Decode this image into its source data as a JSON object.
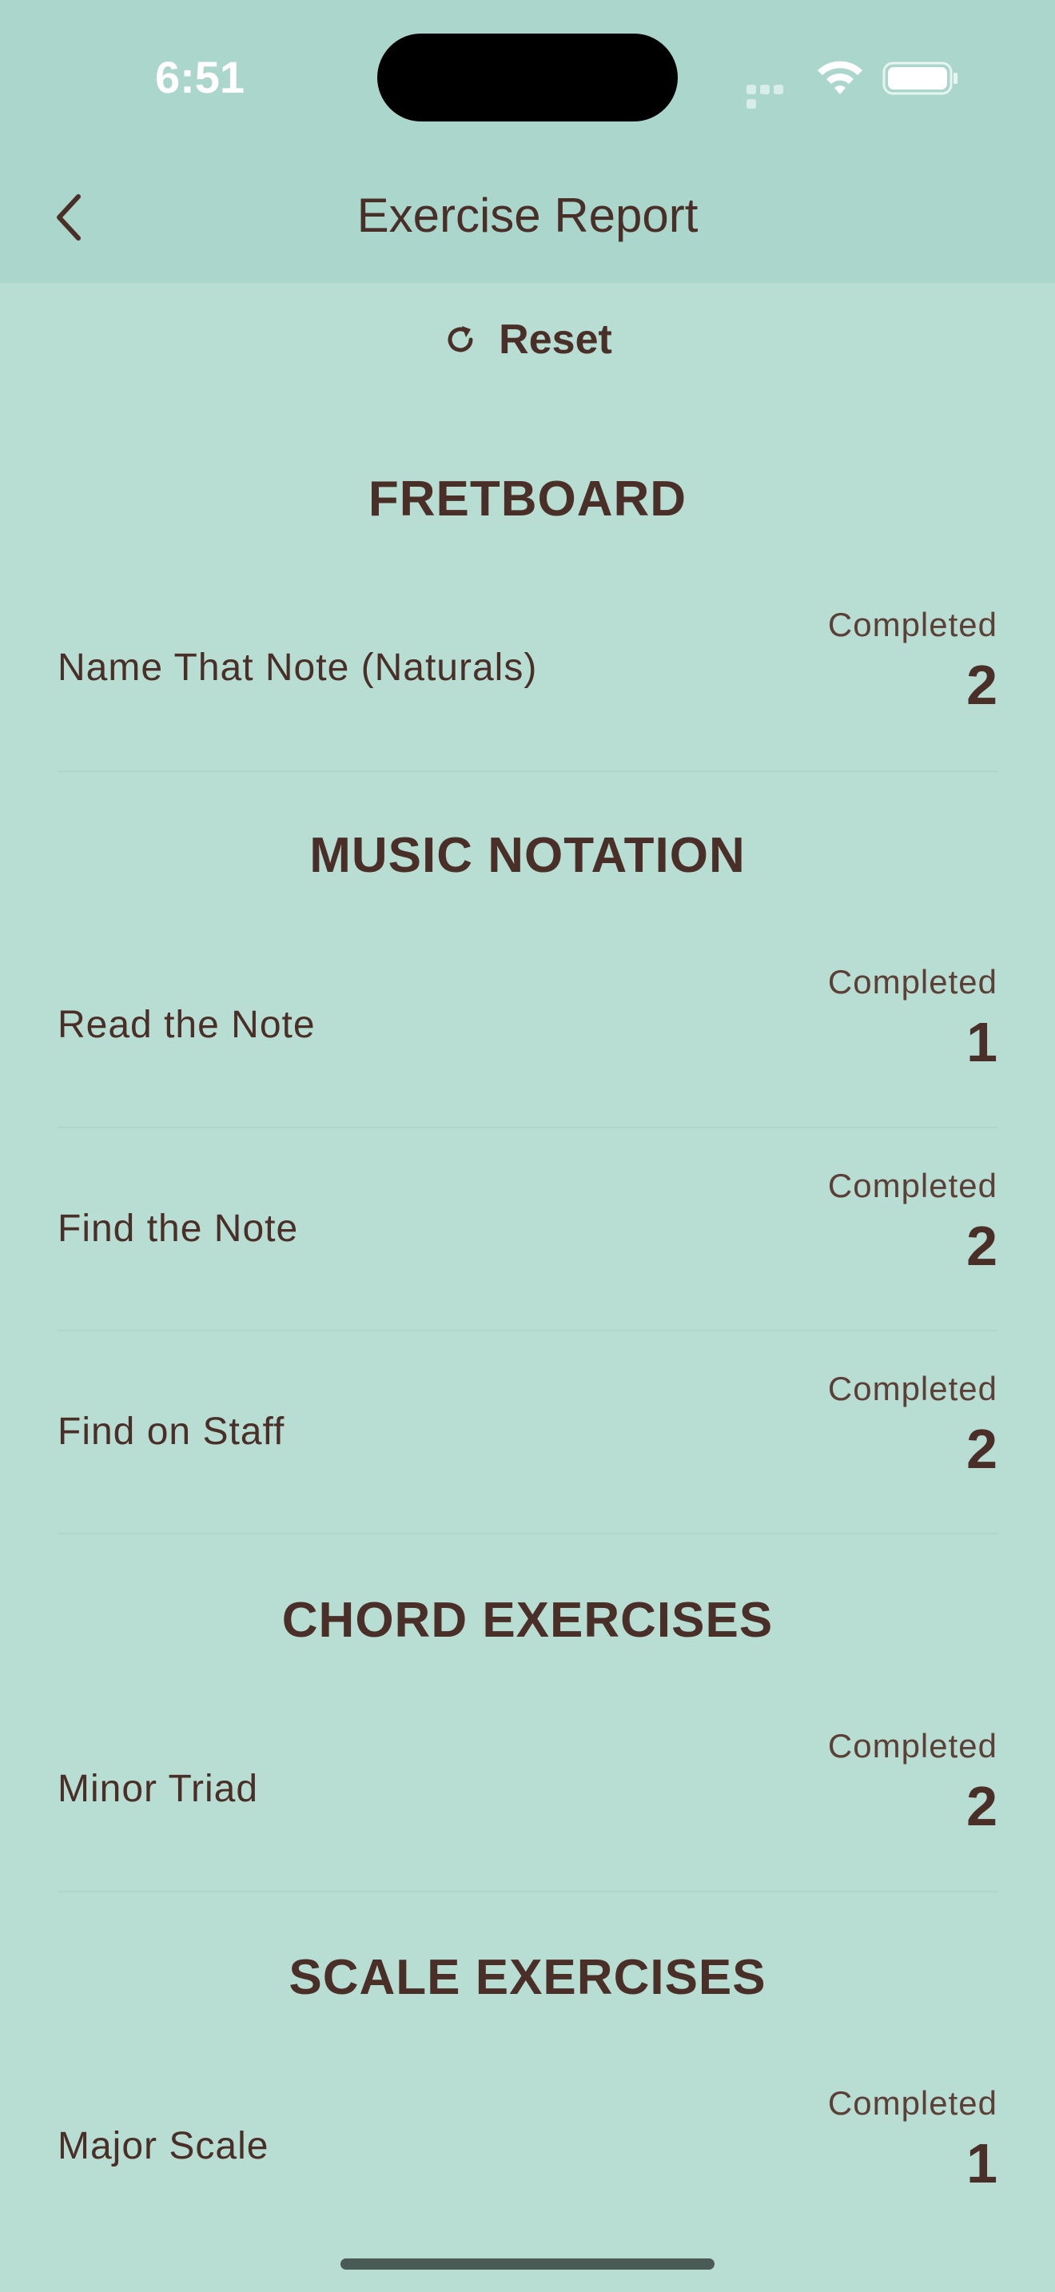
{
  "status": {
    "time": "6:51"
  },
  "header": {
    "title": "Exercise Report"
  },
  "reset": {
    "label": "Reset"
  },
  "sections": [
    {
      "title": "FRETBOARD",
      "items": [
        {
          "label": "Name That Note (Naturals)",
          "caption": "Completed",
          "value": "2"
        }
      ]
    },
    {
      "title": "MUSIC NOTATION",
      "items": [
        {
          "label": "Read the Note",
          "caption": "Completed",
          "value": "1"
        },
        {
          "label": "Find the Note",
          "caption": "Completed",
          "value": "2"
        },
        {
          "label": "Find on Staff",
          "caption": "Completed",
          "value": "2"
        }
      ]
    },
    {
      "title": "CHORD EXERCISES",
      "items": [
        {
          "label": "Minor Triad",
          "caption": "Completed",
          "value": "2"
        }
      ]
    },
    {
      "title": "SCALE EXERCISES",
      "items": [
        {
          "label": "Major Scale",
          "caption": "Completed",
          "value": "1"
        }
      ]
    }
  ],
  "colors": {
    "background": "#b8ddd2",
    "header": "#aad6cb",
    "text": "#4a2f28"
  }
}
